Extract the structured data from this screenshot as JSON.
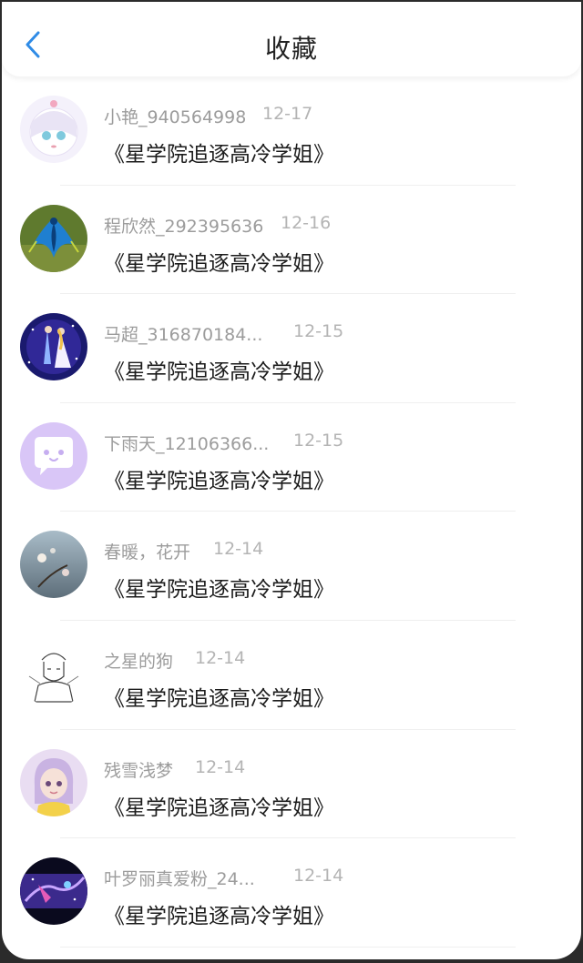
{
  "header": {
    "title": "收藏"
  },
  "items": [
    {
      "name": "小艳_940564998",
      "date": "12-17",
      "book": "《星学院追逐高冷学姐》"
    },
    {
      "name": "程欣然_292395636",
      "date": "12-16",
      "book": "《星学院追逐高冷学姐》"
    },
    {
      "name": "马超_316870184...",
      "date": "12-15",
      "book": "《星学院追逐高冷学姐》"
    },
    {
      "name": "下雨天_12106366...",
      "date": "12-15",
      "book": "《星学院追逐高冷学姐》"
    },
    {
      "name": "春暖，花开",
      "date": "12-14",
      "book": "《星学院追逐高冷学姐》"
    },
    {
      "name": "之星的狗",
      "date": "12-14",
      "book": "《星学院追逐高冷学姐》"
    },
    {
      "name": "残雪浅梦",
      "date": "12-14",
      "book": "《星学院追逐高冷学姐》"
    },
    {
      "name": "叶罗丽真爱粉_24...",
      "date": "12-14",
      "book": "《星学院追逐高冷学姐》"
    }
  ],
  "colors": {
    "accent": "#2f8be6",
    "chat_avatar_bg": "#d9c6f7"
  }
}
